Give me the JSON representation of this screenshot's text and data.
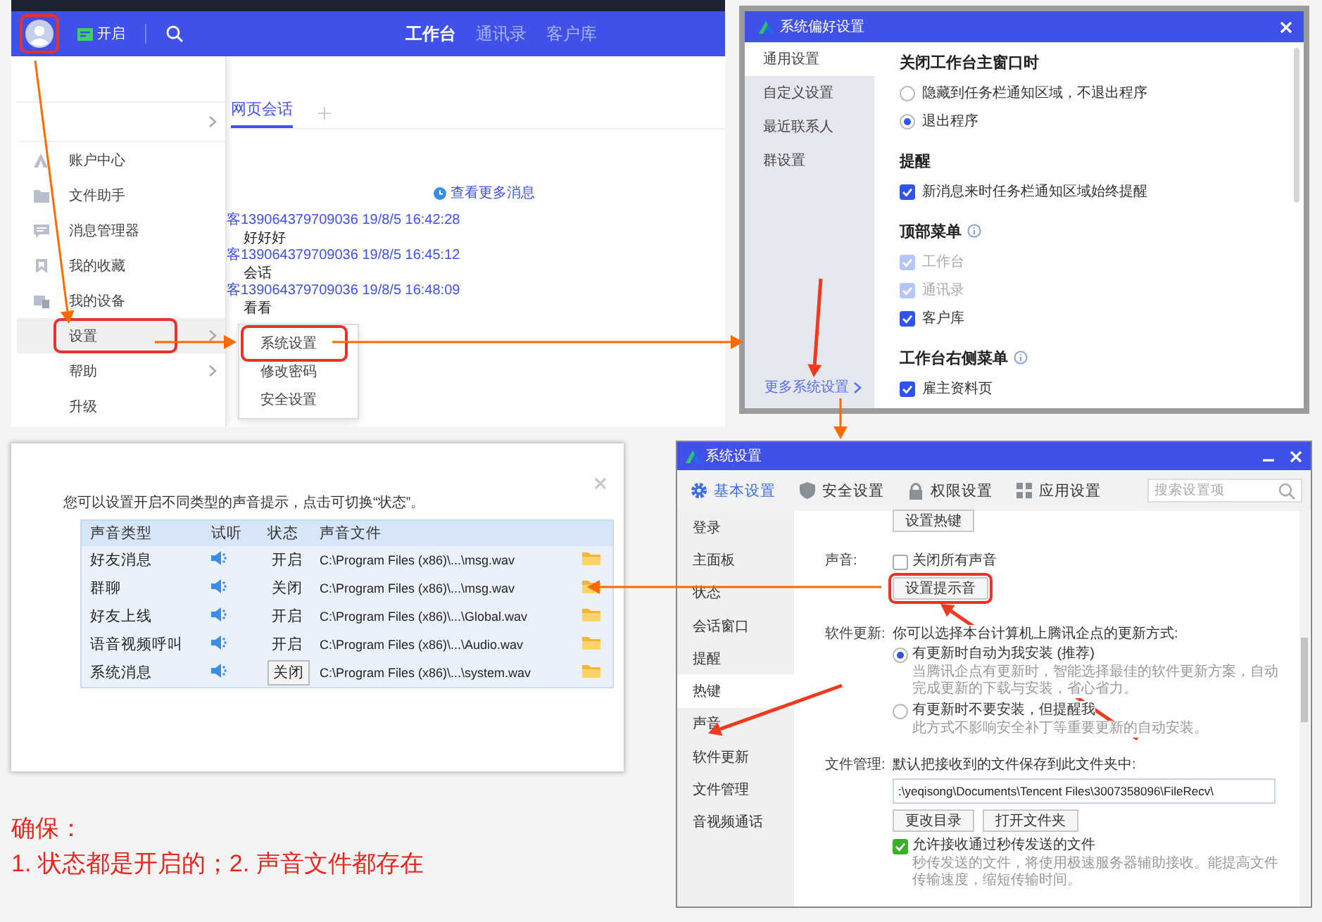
{
  "app_window": {
    "header": {
      "avatar_highlighted": true,
      "start_label": "开启",
      "nav": [
        {
          "label": "工作台",
          "selected": true
        },
        {
          "label": "通讯录",
          "selected": false
        },
        {
          "label": "客户库",
          "selected": false
        }
      ]
    },
    "user_menu": [
      {
        "label": "账户中心",
        "selected": false,
        "submenu": false,
        "highlighted": false
      },
      {
        "label": "文件助手",
        "selected": false,
        "submenu": false,
        "highlighted": false
      },
      {
        "label": "消息管理器",
        "selected": false,
        "submenu": false,
        "highlighted": false
      },
      {
        "label": "我的收藏",
        "selected": false,
        "submenu": false,
        "highlighted": false
      },
      {
        "label": "我的设备",
        "selected": false,
        "submenu": false,
        "highlighted": false
      },
      {
        "label": "设置",
        "selected": true,
        "submenu": true,
        "highlighted": true
      },
      {
        "label": "帮助",
        "selected": false,
        "submenu": true,
        "highlighted": false
      },
      {
        "label": "升级",
        "selected": false,
        "submenu": false,
        "highlighted": false
      }
    ],
    "chat": {
      "tabs": [
        {
          "label": "网页会话",
          "selected": true
        }
      ],
      "more_link": "查看更多消息",
      "messages": [
        {
          "sender": "客139064379709036 19/8/5 16:42:28",
          "text": "好好好"
        },
        {
          "sender": "客139064379709036 19/8/5 16:45:12",
          "text": "会话"
        },
        {
          "sender": "客139064379709036 19/8/5 16:48:09",
          "text": "看看"
        }
      ]
    },
    "submenu": [
      {
        "label": "系统设置",
        "highlighted": true
      },
      {
        "label": "修改密码",
        "highlighted": false
      },
      {
        "label": "安全设置",
        "highlighted": false
      }
    ]
  },
  "preferences_dialog": {
    "title": "系统偏好设置",
    "nav": [
      {
        "label": "通用设置",
        "selected": true
      },
      {
        "label": "自定义设置",
        "selected": false
      },
      {
        "label": "最近联系人",
        "selected": false
      },
      {
        "label": "群设置",
        "selected": false
      }
    ],
    "more_link": "更多系统设置",
    "sections": [
      {
        "heading": "关闭工作台主窗口时",
        "info": false,
        "options": [
          {
            "kind": "radio",
            "label": "隐藏到任务栏通知区域，不退出程序",
            "checked": false,
            "disabled": false
          },
          {
            "kind": "radio",
            "label": "退出程序",
            "checked": true,
            "disabled": false
          }
        ]
      },
      {
        "heading": "提醒",
        "info": false,
        "options": [
          {
            "kind": "checkbox",
            "label": "新消息来时任务栏通知区域始终提醒",
            "checked": true,
            "disabled": false
          }
        ]
      },
      {
        "heading": "顶部菜单",
        "info": true,
        "options": [
          {
            "kind": "checkbox",
            "label": "工作台",
            "checked": true,
            "disabled": true
          },
          {
            "kind": "checkbox",
            "label": "通讯录",
            "checked": true,
            "disabled": true
          },
          {
            "kind": "checkbox",
            "label": "客户库",
            "checked": true,
            "disabled": false
          }
        ]
      },
      {
        "heading": "工作台右侧菜单",
        "info": true,
        "options": [
          {
            "kind": "checkbox",
            "label": "雇主资料页",
            "checked": true,
            "disabled": false
          }
        ]
      }
    ]
  },
  "sound_dialog": {
    "intro": "您可以设置开启不同类型的声音提示，点击可切换“状态”。",
    "columns": [
      "声音类型",
      "试听",
      "状态",
      "声音文件"
    ],
    "rows": [
      {
        "type": "好友消息",
        "status": "开启",
        "file": "C:\\Program Files (x86)\\...\\msg.wav",
        "focused": false
      },
      {
        "type": "群聊",
        "status": "关闭",
        "file": "C:\\Program Files (x86)\\...\\msg.wav",
        "focused": false
      },
      {
        "type": "好友上线",
        "status": "开启",
        "file": "C:\\Program Files (x86)\\...\\Global.wav",
        "focused": false
      },
      {
        "type": "语音视频呼叫",
        "status": "开启",
        "file": "C:\\Program Files (x86)\\...\\Audio.wav",
        "focused": false
      },
      {
        "type": "系统消息",
        "status": "关闭",
        "file": "C:\\Program Files (x86)\\...\\system.wav",
        "focused": true
      }
    ]
  },
  "settings_window": {
    "title": "系统设置",
    "tabs": [
      {
        "label": "基本设置",
        "selected": true
      },
      {
        "label": "安全设置",
        "selected": false
      },
      {
        "label": "权限设置",
        "selected": false
      },
      {
        "label": "应用设置",
        "selected": false
      }
    ],
    "search_placeholder": "搜索设置项",
    "nav": [
      {
        "label": "登录",
        "selected": false
      },
      {
        "label": "主面板",
        "selected": false
      },
      {
        "label": "状态",
        "selected": false
      },
      {
        "label": "会话窗口",
        "selected": false
      },
      {
        "label": "提醒",
        "selected": false
      },
      {
        "label": "热键",
        "selected": true
      },
      {
        "label": "声音",
        "selected": false
      },
      {
        "label": "软件更新",
        "selected": false
      },
      {
        "label": "文件管理",
        "selected": false
      },
      {
        "label": "音视频通话",
        "selected": false
      }
    ],
    "hotkey_button": "设置热键",
    "sound": {
      "label": "声音:",
      "mute_all": {
        "label": "关闭所有声音",
        "checked": false
      },
      "button": "设置提示音",
      "button_highlighted": true
    },
    "update": {
      "label": "软件更新:",
      "intro": "你可以选择本台计算机上腾讯企点的更新方式:",
      "options": [
        {
          "label": "有更新时自动为我安装 (推荐)",
          "selected": true,
          "description": "当腾讯企点有更新时，智能选择最佳的软件更新方案，自动完成更新的下载与安装，省心省力。"
        },
        {
          "label": "有更新时不要安装，但提醒我",
          "selected": false,
          "description": "此方式不影响安全补丁等重要更新的自动安装。"
        }
      ]
    },
    "files": {
      "label": "文件管理:",
      "intro": "默认把接收到的文件保存到此文件夹中:",
      "path": ":\\yeqisong\\Documents\\Tencent Files\\3007358096\\FileRecv\\",
      "buttons": [
        "更改目录",
        "打开文件夹"
      ],
      "allow": {
        "label": "允许接收通过秒传发送的文件",
        "checked": true,
        "description": "秒传发送的文件，将使用极速服务器辅助接收。能提高文件传输速度，缩短传输时间。"
      }
    }
  },
  "note": {
    "title": "确保：",
    "text": "1. 状态都是开启的；2. 声音文件都存在"
  }
}
